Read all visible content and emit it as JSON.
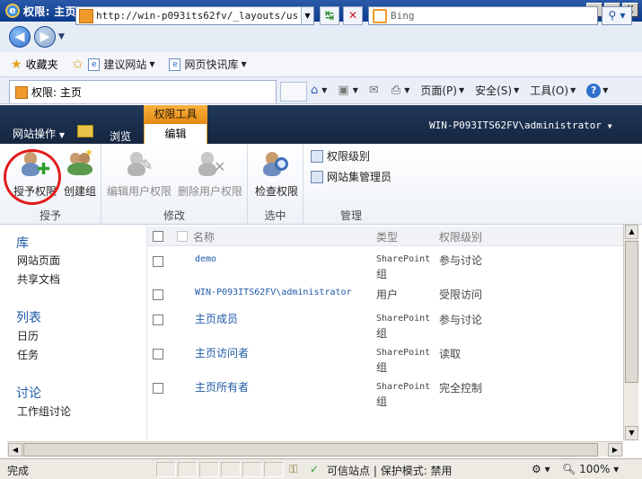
{
  "window": {
    "title": "权限: 主页 - Windows Internet Explorer",
    "min": "_",
    "max": "□",
    "close": "X"
  },
  "address": {
    "url": "http://win-p093its62fv/_layouts/user.a",
    "search_placeholder": "Bing"
  },
  "favorites_bar": {
    "favorites_label": "收藏夹",
    "suggested_sites": "建议网站",
    "web_slice_gallery": "网页快讯库"
  },
  "tab": {
    "title": "权限: 主页"
  },
  "commands": {
    "page": "页面(P)",
    "safety": "安全(S)",
    "tools": "工具(O)",
    "help": "?"
  },
  "sharepoint": {
    "site_actions": "网站操作",
    "browse_tab": "浏览",
    "contextual_group": "权限工具",
    "edit_tab": "编辑",
    "user": "WIN-P093ITS62FV\\administrator"
  },
  "ribbon": {
    "groups": {
      "grant": "授予",
      "modify": "修改",
      "check": "选中",
      "manage": "管理"
    },
    "buttons": {
      "grant_permissions": "授予权限",
      "create_group": "创建组",
      "edit_user_permissions": "编辑用户权限",
      "remove_user_permissions": "删除用户权限",
      "check_permissions": "检查权限",
      "permission_levels": "权限级别",
      "site_collection_admins": "网站集管理员"
    }
  },
  "left_nav": {
    "libraries": "库",
    "site_pages": "网站页面",
    "shared_documents": "共享文档",
    "lists": "列表",
    "calendar": "日历",
    "tasks": "任务",
    "discussions": "讨论",
    "team_discussion": "工作组讨论"
  },
  "list": {
    "headers": {
      "name": "名称",
      "type": "类型",
      "level": "权限级别"
    },
    "rows": [
      {
        "name": "demo",
        "type_line1": "SharePoint",
        "type_line2": "组",
        "level": "参与讨论"
      },
      {
        "name": "WIN-P093ITS62FV\\administrator",
        "type_line1": "用户",
        "type_line2": "",
        "level": "受限访问"
      },
      {
        "name": "主页成员",
        "type_line1": "SharePoint",
        "type_line2": "组",
        "level": "参与讨论"
      },
      {
        "name": "主页访问者",
        "type_line1": "SharePoint",
        "type_line2": "组",
        "level": "读取"
      },
      {
        "name": "主页所有者",
        "type_line1": "SharePoint",
        "type_line2": "组",
        "level": "完全控制"
      }
    ]
  },
  "status": {
    "done": "完成",
    "zone": "可信站点",
    "protected_mode": "保护模式: 禁用",
    "zoom": "100%"
  },
  "colors": {
    "sp_top_bar": "#1b2f4d",
    "contextual_tab": "#f0a030",
    "link_blue": "#1f5aa8",
    "annotation_red": "#e21b1b"
  }
}
